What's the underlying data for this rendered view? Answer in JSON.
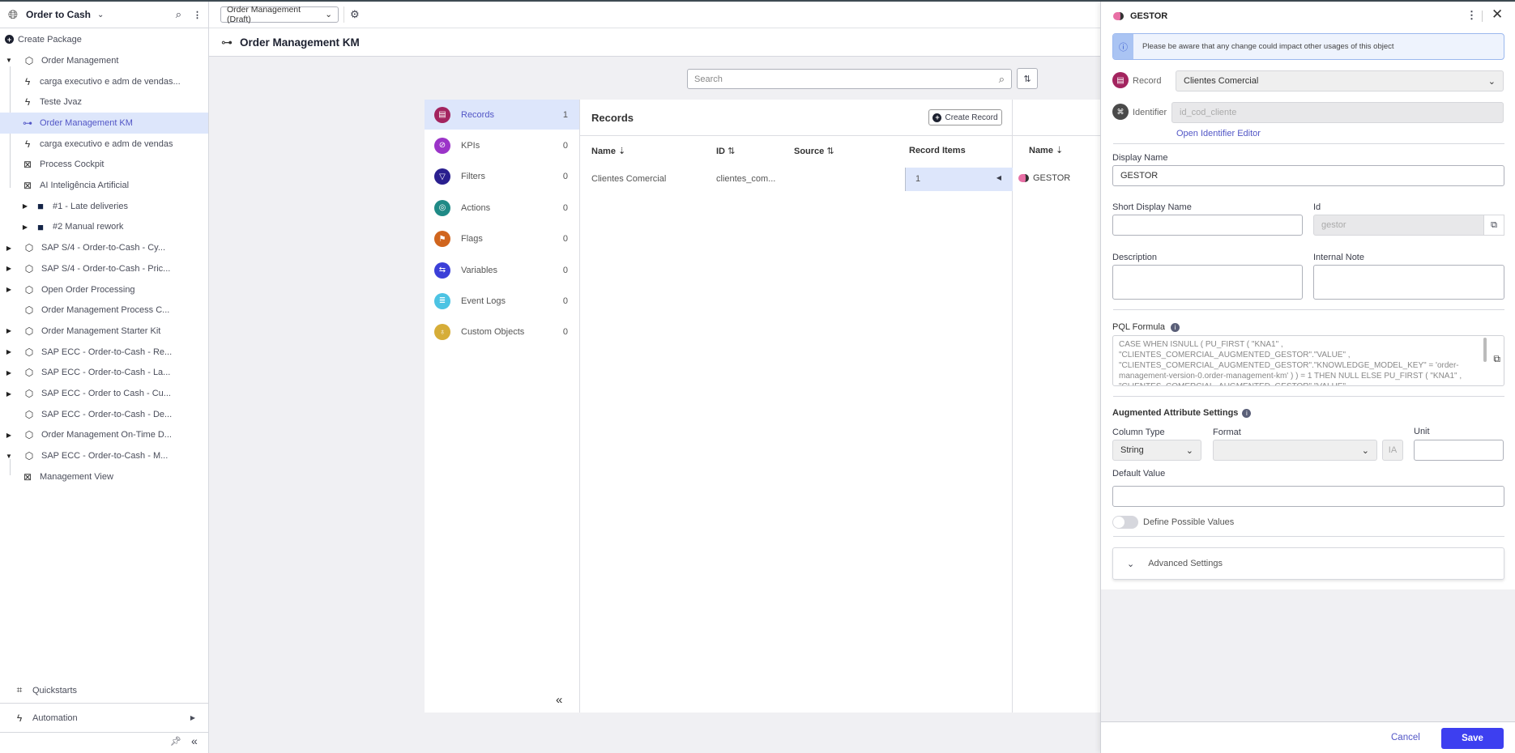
{
  "sidebar": {
    "title": "Order to Cash",
    "create_package": "Create Package",
    "items": [
      {
        "label": "Order Management",
        "icon": "package-icon",
        "indent": 0,
        "caret": "down"
      },
      {
        "label": "carga executivo e adm de vendas...",
        "icon": "lightning-icon",
        "indent": 1
      },
      {
        "label": "Teste Jvaz",
        "icon": "lightning-icon",
        "indent": 1
      },
      {
        "label": "Order Management KM",
        "icon": "knowledge-model-icon",
        "indent": 1,
        "selected": true
      },
      {
        "label": "carga executivo e adm de vendas",
        "icon": "lightning-icon",
        "indent": 1
      },
      {
        "label": "Process Cockpit",
        "icon": "view-icon",
        "indent": 1
      },
      {
        "label": "AI Inteligência Artificial",
        "icon": "view-icon",
        "indent": 1
      },
      {
        "label": "#1 - Late deliveries",
        "icon": "folder-icon",
        "indent": 2,
        "caret": "right"
      },
      {
        "label": "#2 Manual rework",
        "icon": "folder-icon",
        "indent": 2,
        "caret": "right"
      },
      {
        "label": "SAP S/4 - Order-to-Cash - Cy...",
        "icon": "package-icon",
        "indent": 0,
        "caret": "right"
      },
      {
        "label": "SAP S/4 - Order-to-Cash - Pric...",
        "icon": "package-icon",
        "indent": 0,
        "caret": "right"
      },
      {
        "label": "Open Order Processing",
        "icon": "package-icon",
        "indent": 0,
        "caret": "right"
      },
      {
        "label": "Order Management Process C...",
        "icon": "package-icon",
        "indent": 0
      },
      {
        "label": "Order Management Starter Kit",
        "icon": "package-icon",
        "indent": 0,
        "caret": "right"
      },
      {
        "label": "SAP ECC - Order-to-Cash - Re...",
        "icon": "package-icon",
        "indent": 0,
        "caret": "right"
      },
      {
        "label": "SAP ECC - Order-to-Cash - La...",
        "icon": "package-icon",
        "indent": 0,
        "caret": "right"
      },
      {
        "label": "SAP ECC - Order to Cash - Cu...",
        "icon": "package-icon",
        "indent": 0,
        "caret": "right"
      },
      {
        "label": "SAP ECC - Order-to-Cash - De...",
        "icon": "package-icon",
        "indent": 0
      },
      {
        "label": "Order Management On-Time D...",
        "icon": "package-icon",
        "indent": 0,
        "caret": "right"
      },
      {
        "label": "SAP ECC - Order-to-Cash - M...",
        "icon": "package-icon",
        "indent": 0,
        "caret": "down"
      },
      {
        "label": "Management View",
        "icon": "view-icon",
        "indent": 1
      }
    ],
    "quickstarts": "Quickstarts",
    "automation": "Automation"
  },
  "topbar": {
    "version": "Order Management (Draft)",
    "page_title": "Order Management KM",
    "search_placeholder": "Search"
  },
  "menu": [
    {
      "label": "Records",
      "count": "1",
      "color": "#a3245f",
      "glyph": "▤",
      "selected": true
    },
    {
      "label": "KPIs",
      "count": "0",
      "color": "#9b34c8",
      "glyph": "⊘"
    },
    {
      "label": "Filters",
      "count": "0",
      "color": "#2a1f8f",
      "glyph": "▽"
    },
    {
      "label": "Actions",
      "count": "0",
      "color": "#1f8a86",
      "glyph": "◎"
    },
    {
      "label": "Flags",
      "count": "0",
      "color": "#d0651e",
      "glyph": "⚑"
    },
    {
      "label": "Variables",
      "count": "0",
      "color": "#3b3fd8",
      "glyph": "⇆"
    },
    {
      "label": "Event Logs",
      "count": "0",
      "color": "#4cc3e3",
      "glyph": "≣"
    },
    {
      "label": "Custom Objects",
      "count": "0",
      "color": "#d6ad38",
      "glyph": "♁"
    }
  ],
  "records": {
    "title": "Records",
    "create_label": "Create Record",
    "columns": [
      "Name",
      "ID",
      "Source",
      "Record Items"
    ],
    "rows": [
      {
        "name": "Clientes Comercial",
        "id": "clientes_com...",
        "source": "",
        "items": "1"
      }
    ],
    "items_column": "Name",
    "items": [
      "GESTOR"
    ]
  },
  "panel": {
    "title": "GESTOR",
    "notice": "Please be aware that any change could impact other usages of this object",
    "record_label": "Record",
    "record_value": "Clientes Comercial",
    "identifier_label": "Identifier",
    "identifier_value": "id_cod_cliente",
    "open_identifier": "Open Identifier Editor",
    "display_name_label": "Display Name",
    "display_name": "GESTOR",
    "short_display_label": "Short Display Name",
    "short_display": "",
    "id_label": "Id",
    "id_value": "gestor",
    "description_label": "Description",
    "internal_note_label": "Internal Note",
    "pql_label": "PQL Formula",
    "pql": "CASE WHEN ISNULL ( PU_FIRST ( \"KNA1\" , \"CLIENTES_COMERCIAL_AUGMENTED_GESTOR\".\"VALUE\" , \"CLIENTES_COMERCIAL_AUGMENTED_GESTOR\".\"KNOWLEDGE_MODEL_KEY\" = 'order-management-version-0.order-management-km' ) ) = 1 THEN NULL ELSE PU_FIRST ( \"KNA1\" , \"CLIENTES_COMERCIAL_AUGMENTED_GESTOR\".\"VALUE\"",
    "augmented_label": "Augmented Attribute Settings",
    "column_type_label": "Column Type",
    "column_type": "String",
    "format_label": "Format",
    "format_value": "",
    "unit_label": "Unit",
    "unit_value": "",
    "default_label": "Default Value",
    "default_value": "",
    "define_values": "Define Possible Values",
    "define_values_on": false,
    "advanced": "Advanced Settings",
    "cancel": "Cancel",
    "save": "Save",
    "accent": "#3d3ff0"
  }
}
